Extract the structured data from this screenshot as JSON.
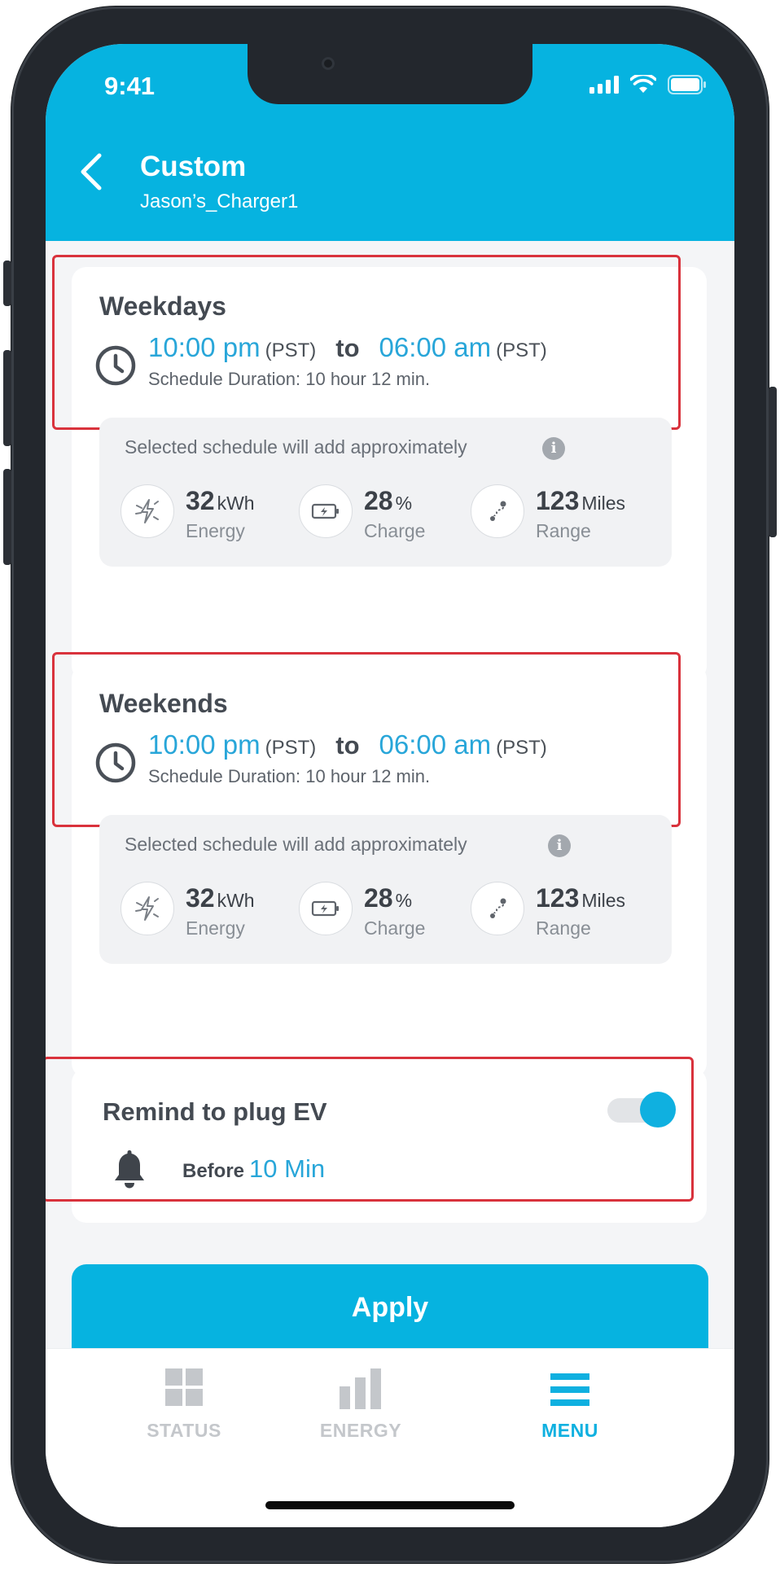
{
  "status_bar": {
    "time": "9:41"
  },
  "header": {
    "title": "Custom",
    "subtitle": "Jason’s_Charger1"
  },
  "weekdays": {
    "title": "Weekdays",
    "start": "10:00 pm",
    "start_tz": "(PST)",
    "to": "to",
    "end": "06:00 am",
    "end_tz": "(PST)",
    "duration": "Schedule Duration: 10 hour 12 min.",
    "info_heading": "Selected schedule will add approximately",
    "info_icon": "i",
    "stats": [
      {
        "icon": "energy-icon",
        "value": "32",
        "unit": "kWh",
        "label": "Energy"
      },
      {
        "icon": "battery-charge-icon",
        "value": "28",
        "unit": "%",
        "label": "Charge"
      },
      {
        "icon": "route-icon",
        "value": "123",
        "unit": "Miles",
        "label": "Range"
      }
    ]
  },
  "weekends": {
    "title": "Weekends",
    "start": "10:00 pm",
    "start_tz": "(PST)",
    "to": "to",
    "end": "06:00 am",
    "end_tz": "(PST)",
    "duration": "Schedule Duration: 10 hour 12 min.",
    "info_heading": "Selected schedule will add approximately",
    "info_icon": "i",
    "stats": [
      {
        "icon": "energy-icon",
        "value": "32",
        "unit": "kWh",
        "label": "Energy"
      },
      {
        "icon": "battery-charge-icon",
        "value": "28",
        "unit": "%",
        "label": "Charge"
      },
      {
        "icon": "route-icon",
        "value": "123",
        "unit": "Miles",
        "label": "Range"
      }
    ]
  },
  "reminder": {
    "title": "Remind to plug EV",
    "enabled": true,
    "before_label": "Before",
    "before_value": "10 Min"
  },
  "apply_label": "Apply",
  "tabs": [
    {
      "label": "STATUS",
      "icon": "grid-icon",
      "active": false
    },
    {
      "label": "ENERGY",
      "icon": "bar-chart-icon",
      "active": false
    },
    {
      "label": "MENU",
      "icon": "menu-icon",
      "active": true
    }
  ],
  "colors": {
    "brand": "#06b3e0",
    "accent_text": "#28a6d9",
    "highlight_border": "#d9323c",
    "tab_inactive": "#c4c7cb"
  }
}
